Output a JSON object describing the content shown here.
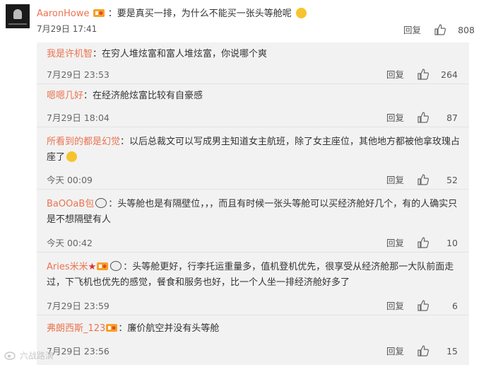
{
  "main_comment": {
    "username": "AaronHowe",
    "text": "：要是真买一排，为什么不能买一张头等舱呢",
    "date": "7月29日 17:41",
    "reply_label": "回复",
    "likes": "808"
  },
  "replies": [
    {
      "username": "我是许机智",
      "text": "：在穷人堆炫富和富人堆炫富，你说哪个爽",
      "date": "7月29日 23:53",
      "reply_label": "回复",
      "likes": "264"
    },
    {
      "username": "嗯嗯几好",
      "text": "：在经济舱炫富比较有自豪感",
      "date": "7月29日 18:04",
      "reply_label": "回复",
      "likes": "87"
    },
    {
      "username": "所看到的都是幻觉",
      "text": "：以后总裁文可以写成男主知道女主航班，除了女主座位，其他地方都被他拿玫瑰占座了",
      "date": "今天 00:09",
      "reply_label": "回复",
      "likes": "52"
    },
    {
      "username": "BaOOaB包",
      "text": "：头等舱也是有隔壁位，，，而且有时候一张头等舱可以买经济舱好几个，有的人确实只是不想隔壁有人",
      "date": "今天 00:42",
      "reply_label": "回复",
      "likes": "10"
    },
    {
      "username": "Aries米米",
      "text": "：头等舱更好，行李托运重量多，值机登机优先，很享受从经济舱那一大队前面走过，下飞机也优先的感觉，餐食和服务也好，比一个人坐一排经济舱好多了",
      "date": "7月29日 23:59",
      "reply_label": "回复",
      "likes": "6"
    },
    {
      "username": "弗朗西斯_123",
      "text": "：廉价航空并没有头等舱",
      "date": "7月29日 23:56",
      "reply_label": "回复",
      "likes": "15"
    }
  ],
  "watermark": "六战路演",
  "colors": {
    "username": "#eb7350",
    "reply_username": "#eb7350",
    "reply_bg": "#f2f2f2"
  }
}
